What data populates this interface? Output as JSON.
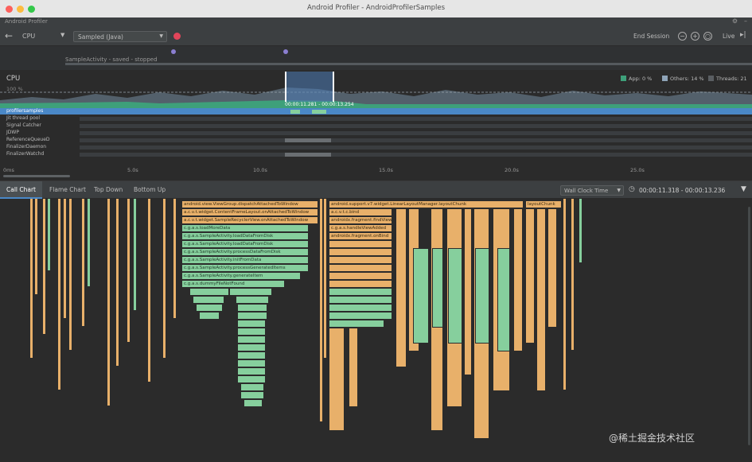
{
  "window": {
    "title": "Android Profiler - AndroidProfilerSamples",
    "app_label": "Android Profiler",
    "traffic_colors": [
      "#fc605c",
      "#fdbc40",
      "#34c84a"
    ]
  },
  "toolbar": {
    "back_icon": "back-arrow-icon",
    "profiler_label": "CPU",
    "config_value": "Sampled (Java)",
    "end_session_label": "End Session",
    "live_label": "Live"
  },
  "events": {
    "activity_label": "SampleActivity - saved - stopped"
  },
  "cpu": {
    "title": "CPU",
    "percent_label": "100 %",
    "legend": [
      {
        "label": "App: 0 %",
        "color": "#3ea07a"
      },
      {
        "label": "Others: 14 %",
        "color": "#8fa4b8"
      },
      {
        "label": "Threads: 21",
        "color": "#5a5e62"
      }
    ],
    "selection_time": "00:00:11.281 - 00:00:13.254",
    "accent": "#4a88c7"
  },
  "threads": [
    {
      "name": "profilersamples",
      "selected": true
    },
    {
      "name": "Jit thread pool",
      "selected": false
    },
    {
      "name": "Signal Catcher",
      "selected": false
    },
    {
      "name": "JDWP",
      "selected": false
    },
    {
      "name": "ReferenceQueueD",
      "selected": false
    },
    {
      "name": "FinalizerDaemon",
      "selected": false
    },
    {
      "name": "FinalizerWatchd",
      "selected": false
    }
  ],
  "time_axis": {
    "labels": [
      "0ms",
      "5.0s",
      "10.0s",
      "15.0s",
      "20.0s",
      "25.0s"
    ]
  },
  "tabs": [
    {
      "label": "Call Chart",
      "active": true
    },
    {
      "label": "Flame Chart",
      "active": false
    },
    {
      "label": "Top Down",
      "active": false
    },
    {
      "label": "Bottom Up",
      "active": false
    }
  ],
  "clock": {
    "value": "Wall Clock Time",
    "range": "00:00:11.318 - 00:00:13.236"
  },
  "call_chart": {
    "left_stack": [
      "android.view.ViewGroup.dispatchAttachedToWindow",
      "a.c.v.t.widget.ContentFrameLayout.onAttachedToWindow",
      "a.c.v.t.widget.SampleRecyclerView.onAttachedToWindow",
      "c.g.a.s.loadMoreData",
      "c.g.a.s.SampleActivity.loadDataFromDisk",
      "c.g.a.s.SampleActivity.loadDataFromDisk",
      "c.g.a.s.SampleActivity.processDataFromDisk",
      "c.g.a.s.SampleActivity.initFromData",
      "c.g.a.s.SampleActivity.processGeneratedItems",
      "c.g.a.s.SampleActivity.generateItem",
      "c.g.a.s.dummyFileNotFound"
    ],
    "right_stack": [
      "android.support.v7.widget.LinearLayoutManager.layoutChunk",
      "a.c.v.t.c.bind",
      "androidx.fragment.findView",
      "c.g.a.s.handleViewAdded",
      "androidx.fragment.onBind"
    ],
    "far_right_label": "layoutChunk"
  },
  "watermark": "@稀土掘金技术社区"
}
